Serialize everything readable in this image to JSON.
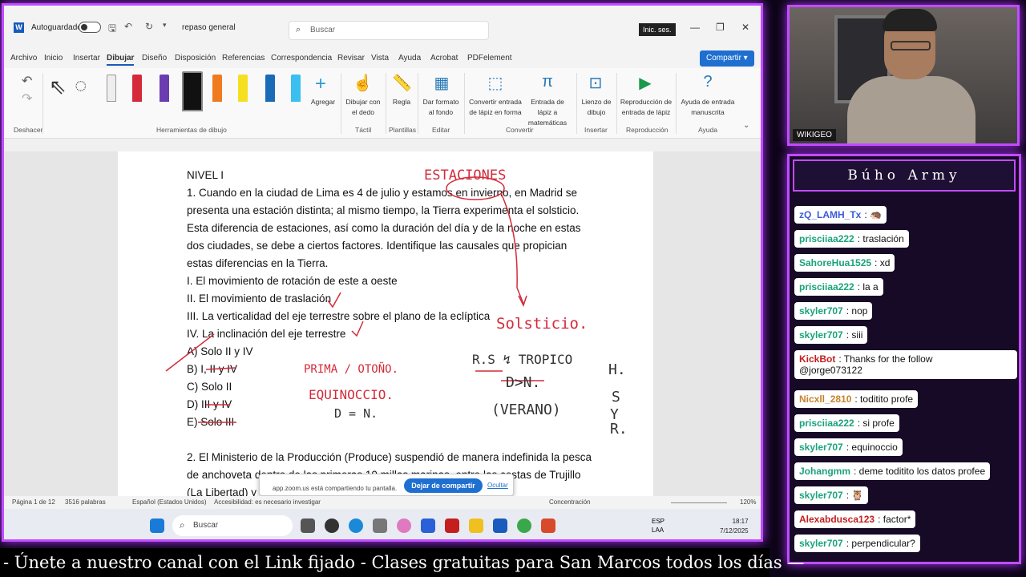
{
  "word": {
    "autosave_label": "Autoguardado",
    "doc_name": "repaso general",
    "search_placeholder": "Buscar",
    "sign_in": "Inic. ses.",
    "share": "Compartir",
    "tabs": [
      "Archivo",
      "Inicio",
      "Insertar",
      "Dibujar",
      "Diseño",
      "Disposición",
      "Referencias",
      "Correspondencia",
      "Revisar",
      "Vista",
      "Ayuda",
      "Acrobat",
      "PDFelement"
    ],
    "ribbon": {
      "undo_label": "Deshacer",
      "drawing_tools_label": "Herramientas de dibujo",
      "add_label": "Agregar",
      "draw_finger": "Dibujar con el dedo",
      "touch_label": "Táctil",
      "ruler": "Regla",
      "stencils_label": "Plantillas",
      "format_bg": "Dar formato al fondo",
      "edit_label": "Editar",
      "ink_to_shape": "Convertir entrada de lápiz en forma",
      "ink_to_math": "Entrada de lápiz a matemáticas",
      "convert_label": "Convertir",
      "canvas": "Lienzo de dibujo",
      "insert_label": "Insertar",
      "ink_replay": "Reproducción de entrada de lápiz",
      "replay_label": "Reproducción",
      "ink_help": "Ayuda de entrada manuscrita",
      "help_label": "Ayuda"
    },
    "doc_lines": [
      "NIVEL I",
      "1. Cuando en la ciudad de Lima es 4 de julio y estamos en invierno, en Madrid se",
      "presenta una estación distinta; al mismo tiempo, la Tierra experimenta el solsticio.",
      "Esta diferencia de estaciones, así como la duración del día y de la noche en estas",
      "dos ciudades, se debe a ciertos factores. Identifique las causales que propician",
      "estas diferencias en la Tierra.",
      "I. El movimiento de rotación de este a oeste",
      "II. El movimiento de traslación",
      "III. La verticalidad del eje terrestre sobre el plano de la eclíptica",
      "IV. La inclinación del eje terrestre",
      "A) Solo II y IV",
      "B) I, II y IV",
      "C) Solo II",
      "D) III y IV",
      "E) Solo III",
      "2. El Ministerio de la Producción (Produce) suspendió de manera indefinida la pesca",
      "de anchoveta dentro de las primeras 10 millas marinas, entre las costas de Trujillo",
      "(La Libertad) y"
    ],
    "handwriting": {
      "estaciones": "ESTACIONES",
      "solsticio": "Solsticio.",
      "prima": "PRIMA / OTOÑO.",
      "equinoccio": "EQUINOCCIO.",
      "den": "D = N.",
      "rs": "R.S ↯ TROPICO",
      "dgn": "D>N.",
      "verano": "(VERANO)",
      "h": "H.",
      "s": "S",
      "y": "Y",
      "r": "R."
    },
    "share_notice": {
      "message": "app.zoom.us está compartiendo tu pantalla.",
      "stop": "Dejar de compartir",
      "hide": "Ocultar"
    },
    "status": {
      "page": "Página 1 de 12",
      "words": "3516 palabras",
      "lang": "Español (Estados Unidos)",
      "access": "Accesibilidad: es necesario investigar",
      "focus": "Concentración",
      "zoom": "120%"
    },
    "taskbar": {
      "search": "Buscar",
      "lang": "ESP",
      "layout": "LAA",
      "time": "18:17",
      "date": "7/12/2025"
    }
  },
  "cam": {
    "tag": "WIKIGEO"
  },
  "chat": {
    "title": "Búho Army",
    "messages": [
      {
        "user": "zQ_LAMH_Tx",
        "text": "",
        "color": "#3a5bd8",
        "emoji": "🦔"
      },
      {
        "user": "prisciiaa222",
        "text": "traslación",
        "color": "#1aa37a"
      },
      {
        "user": "SahoreHua1525",
        "text": "xd",
        "color": "#1aa37a"
      },
      {
        "user": "prisciiaa222",
        "text": "la a",
        "color": "#1aa37a"
      },
      {
        "user": "skyler707",
        "text": "nop",
        "color": "#1aa37a"
      },
      {
        "user": "skyler707",
        "text": "siii",
        "color": "#1aa37a"
      },
      {
        "user": "KickBot",
        "text": "Thanks for the follow",
        "extra": "@jorge073122",
        "color": "#c41e1e"
      },
      {
        "user": "Nicxll_2810",
        "text": "toditito profe",
        "color": "#c9822a"
      },
      {
        "user": "prisciiaa222",
        "text": "si profe",
        "color": "#1aa37a"
      },
      {
        "user": "skyler707",
        "text": "equinoccio",
        "color": "#1aa37a"
      },
      {
        "user": "Johangmm",
        "text": "deme toditito los datos profee",
        "color": "#1aa37a"
      },
      {
        "user": "skyler707",
        "text": "",
        "color": "#1aa37a",
        "emoji": "🦉"
      },
      {
        "user": "Alexabdusca123",
        "text": "factor*",
        "color": "#c41e1e"
      },
      {
        "user": "skyler707",
        "text": "perpendicular?",
        "color": "#1aa37a"
      }
    ]
  },
  "ticker": "-  Únete a nuestro canal con el Link fijado  -  Clases gratuitas para San Marcos todos los días  —",
  "colors": {
    "neon": "#c04dff",
    "word_blue": "#185abd",
    "ink": "#d42a3a"
  }
}
